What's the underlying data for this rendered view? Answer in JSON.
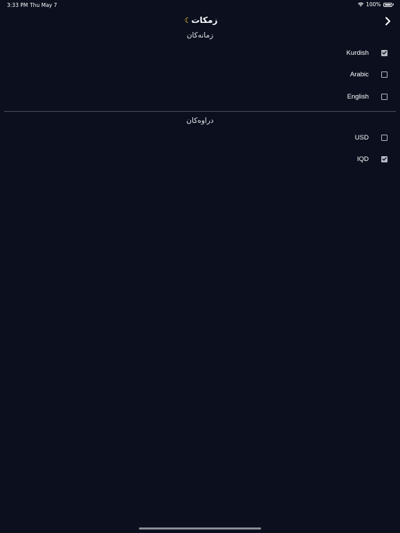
{
  "status_bar": {
    "time": "3:33 PM",
    "date": "Thu May 7",
    "battery": "100%",
    "battery_level": 1.0
  },
  "header": {
    "title": "زمكات",
    "title_icon": "moon-icon",
    "back_icon": "chevron-right-icon"
  },
  "languages": {
    "header": "زمانەکان",
    "options": [
      {
        "label": "Kurdish",
        "checked": true
      },
      {
        "label": "Arabic",
        "checked": false
      },
      {
        "label": "English",
        "checked": false
      }
    ]
  },
  "currencies": {
    "header": "دراوەکان",
    "options": [
      {
        "label": "USD",
        "checked": false
      },
      {
        "label": "IQD",
        "checked": true
      }
    ]
  },
  "colors": {
    "background": "#0b0f1e",
    "divider": "#4a4f5c",
    "checkbox": "#b8bac2",
    "moon": "#f7c948"
  }
}
